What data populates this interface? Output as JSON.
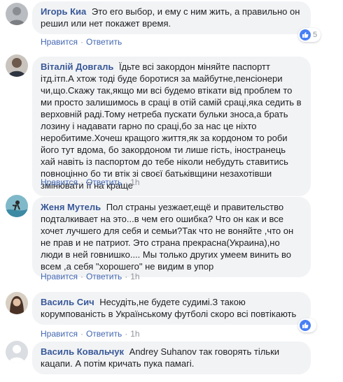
{
  "actions": {
    "like": "Нравится",
    "reply": "Ответить",
    "separator": "·"
  },
  "comments": [
    {
      "author": "Игорь Киа",
      "text": "Это его выбор, и ему с ним жить, а правильно он решил или нет покажет время.",
      "time": "",
      "reactions": {
        "type": "like-icon",
        "count": "5"
      }
    },
    {
      "author": "Віталій Довгаль",
      "text": "Їдьте всі закордон міняйте паспортт ітд.ітп.А хтож тоді буде боротися за майбутне,пенсіонери чи,що.Скажу так,якщо ми всі будемо втікати від проблем то ми просто залишимось в сраці в отій самій сраці,яка седить в верховній раді.Тому нетреба пускати бульки зноса,а брать лозину і надавати гарно по сраці,бо за нас це ніхто неробитиме.Хочеш кращого життя,як за кордоном то роби його тут вдома, бо закордоном ти лише гість, іностранець хай навіть із паспортом до тебе ніколи небудуть ставитись повноцінно бо ти втік зі своєї батьківщини незахотівши змінювати її на краще",
      "time": "1h"
    },
    {
      "author": "Женя Мутель",
      "text": "Пол страны уезжает,ещё и правительство подталкивает на это...в чем его ошибка? Что он как и все хочет лучшего для себя и семьи?Так что не воняйте ,что он не прав и не патриот. Это страна прекрасна(Украина),но люди в ней говнишко.... Мы только других умеем винить во всем ,а себя \"хорошего\" не видим в упор",
      "time": "1h"
    },
    {
      "author": "Василь Сич",
      "text": "Несудіть,не будете судимі.З такою корумпованість в Українському футболі скоро всі повтікають",
      "time": "1h",
      "reactions": {
        "type": "like-icon",
        "count": ""
      }
    },
    {
      "author": "Василь Ковальчук",
      "text": "Andrey Suhanov так говорять тільки кацапи. А потім кричать пука памагі.",
      "time": ""
    }
  ]
}
